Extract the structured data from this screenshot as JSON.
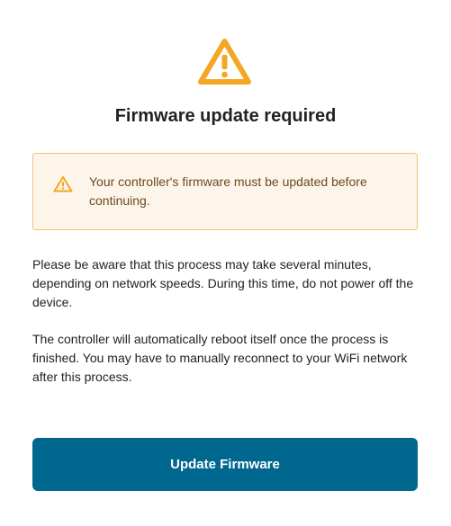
{
  "icons": {
    "hero": "warning-icon",
    "alert": "warning-icon"
  },
  "colors": {
    "warning_icon": "#f5a623",
    "alert_background": "#fef5ea",
    "alert_border": "#f2c27a",
    "alert_text": "#6b4a1e",
    "button_background": "#00678f",
    "button_text": "#ffffff"
  },
  "title": "Firmware update required",
  "alert": {
    "message": "Your controller's firmware must be updated before continuing."
  },
  "paragraphs": [
    "Please be aware that this process may take several minutes, depending on network speeds. During this time, do not power off the device.",
    "The controller will automatically reboot itself once the process is finished. You may have to manually reconnect to your WiFi network after this process."
  ],
  "button": {
    "label": "Update Firmware"
  }
}
